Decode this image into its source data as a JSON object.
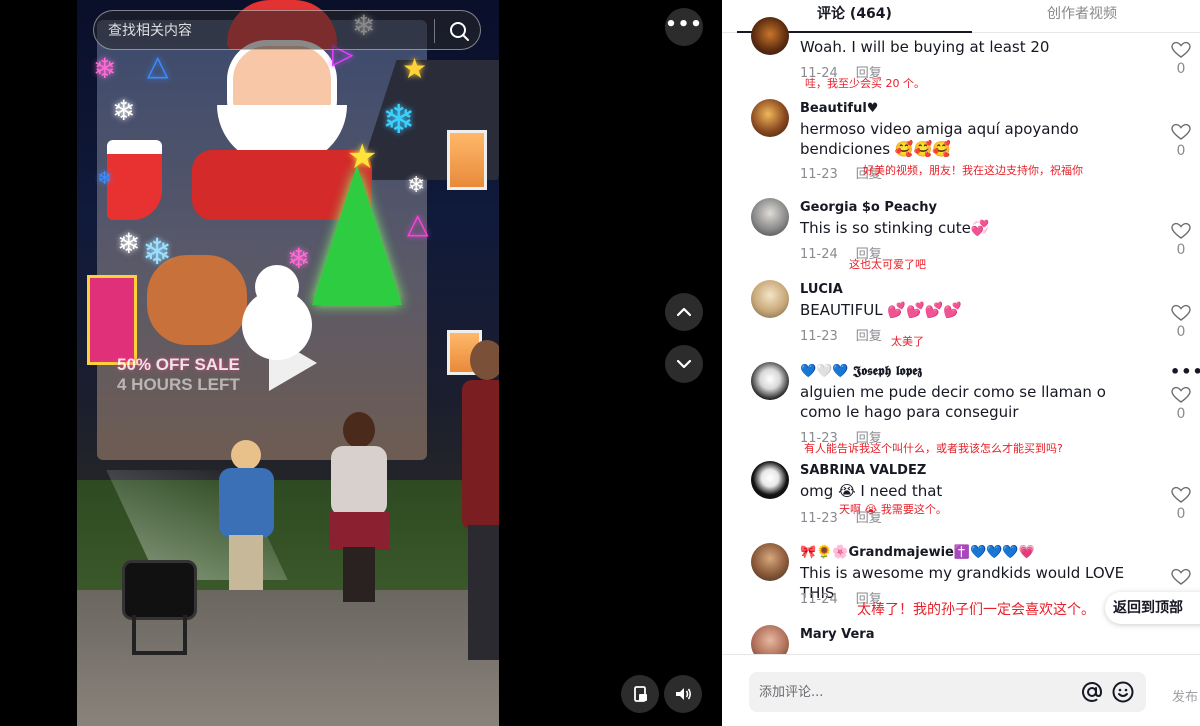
{
  "search": {
    "placeholder": "查找相关内容"
  },
  "video": {
    "sale_line1": "50% OFF SALE",
    "sale_line2": "4 HOURS LEFT"
  },
  "tabs": [
    {
      "label": "评论 (464)",
      "active": true
    },
    {
      "label": "创作者视频",
      "active": false
    }
  ],
  "comments": [
    {
      "user": "",
      "text": "Woah. I will be buying at least 20",
      "date": "11-24",
      "reply": "回复",
      "translation": "哇，我至少会买 20 个。",
      "likes": "0"
    },
    {
      "user": "Beautiful♥",
      "text": "hermoso video amiga aquí apoyando bendiciones 🥰🥰🥰",
      "date": "11-23",
      "reply": "回复",
      "translation": "好美的视频，朋友！我在这边支持你，祝福你",
      "likes": "0"
    },
    {
      "user": "Georgia $o Peachy",
      "text": "This is so stinking cute💞",
      "date": "11-24",
      "reply": "回复",
      "translation": "这也太可爱了吧",
      "likes": "0"
    },
    {
      "user": "LUCIA",
      "text": "BEAUTIFUL 💕💕💕💕",
      "date": "11-23",
      "reply": "回复",
      "translation": "太美了",
      "likes": "0"
    },
    {
      "user": "💙🤍💙 𝕵𝖔𝖘𝖊𝖕𝖍 𝖑𝖔𝖕𝖊𝖟",
      "text": "alguien me pude decir como se llaman o como le hago para conseguir",
      "date": "11-23",
      "reply": "回复",
      "translation": "有人能告诉我这个叫什么，或者我该怎么才能买到吗?",
      "likes": "0",
      "more": "•••"
    },
    {
      "user": "SABRINA VALDEZ",
      "text": "omg 😭 I need that",
      "date": "11-23",
      "reply": "回复",
      "translation": "天啊 😭 我需要这个。",
      "likes": "0"
    },
    {
      "user": "🎀🌻🌸Grandmajewie✝️💙💙💙💗",
      "text": "This is awesome my grandkids would LOVE THIS",
      "date": "11-24",
      "reply": "回复",
      "translation": "太棒了！我的孙子们一定会喜欢这个。",
      "likes": ""
    },
    {
      "user": "Mary Vera",
      "text": "",
      "date": "",
      "reply": "",
      "translation": "",
      "likes": ""
    }
  ],
  "back_to_top": "返回到顶部",
  "composer": {
    "placeholder": "添加评论...",
    "post": "发布"
  },
  "colors": {
    "translation_red": "#e8202a",
    "muted": "#8a8b91",
    "text": "#161823"
  }
}
